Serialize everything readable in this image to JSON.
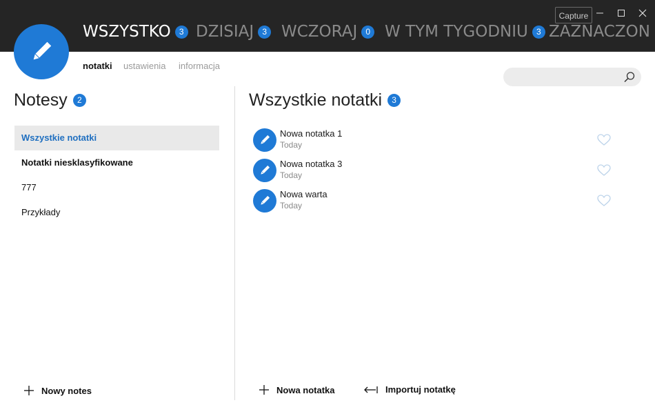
{
  "window": {
    "capture_label": "Capture"
  },
  "categories": [
    {
      "label": "WSZYSTKO",
      "count": "3"
    },
    {
      "label": "DZISIAJ",
      "count": "3"
    },
    {
      "label": "WCZORAJ",
      "count": "0"
    },
    {
      "label": "W TYM TYGODNIU",
      "count": "3"
    },
    {
      "label": "ZAZNACZON"
    }
  ],
  "subnav": [
    {
      "label": "notatki"
    },
    {
      "label": "ustawienia"
    },
    {
      "label": "informacja"
    }
  ],
  "search": {
    "placeholder": ""
  },
  "notebooks": {
    "title": "Notesy",
    "count": "2",
    "items": [
      {
        "label": "Wszystkie notatki"
      },
      {
        "label": "Notatki niesklasyfikowane"
      },
      {
        "label": "777"
      },
      {
        "label": "Przykłady"
      }
    ],
    "add_label": "Nowy notes"
  },
  "notes": {
    "title": "Wszystkie notatki",
    "count": "3",
    "items": [
      {
        "title": "Nowa notatka 1",
        "date": "Today"
      },
      {
        "title": "Nowa notatka 3",
        "date": "Today"
      },
      {
        "title": "Nowa warta",
        "date": "Today"
      }
    ],
    "new_label": "Nowa notatka",
    "import_label": "Importuj notatkę"
  },
  "colors": {
    "accent": "#1f7ad6",
    "topbar": "#252525",
    "selected_bg": "#e9e9e9"
  },
  "icons": [
    "pencil-icon",
    "minimize-icon",
    "maximize-icon",
    "close-icon",
    "search-icon",
    "heart-icon",
    "plus-icon",
    "import-arrow-icon"
  ]
}
